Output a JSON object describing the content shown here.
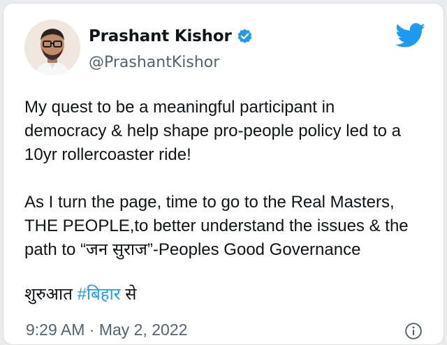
{
  "tweet": {
    "author": {
      "display_name": "Prashant Kishor",
      "handle": "@PrashantKishor",
      "verified": true,
      "avatar_icon": "profile-photo"
    },
    "body": {
      "line1": "My quest to be a meaningful participant in",
      "line2": "democracy & help shape pro-people policy led to a",
      "line3": "10yr rollercoaster ride!",
      "line4": "As I turn the page, time to go to the Real Masters,",
      "line5": "THE PEOPLE,to better understand the issues & the",
      "line6": "path to “जन सुराज”-Peoples Good Governance"
    },
    "footer_line": {
      "prefix": "शुरुआत ",
      "hashtag": "#बिहार",
      "suffix": " से"
    },
    "timestamp": "9:29 AM · May 2, 2022",
    "icons": {
      "brand": "twitter-bird-icon",
      "verified": "verified-badge-icon",
      "info": "info-icon"
    },
    "colors": {
      "brand_blue": "#1d9bf0",
      "text": "#0f1419",
      "muted": "#536471"
    }
  }
}
